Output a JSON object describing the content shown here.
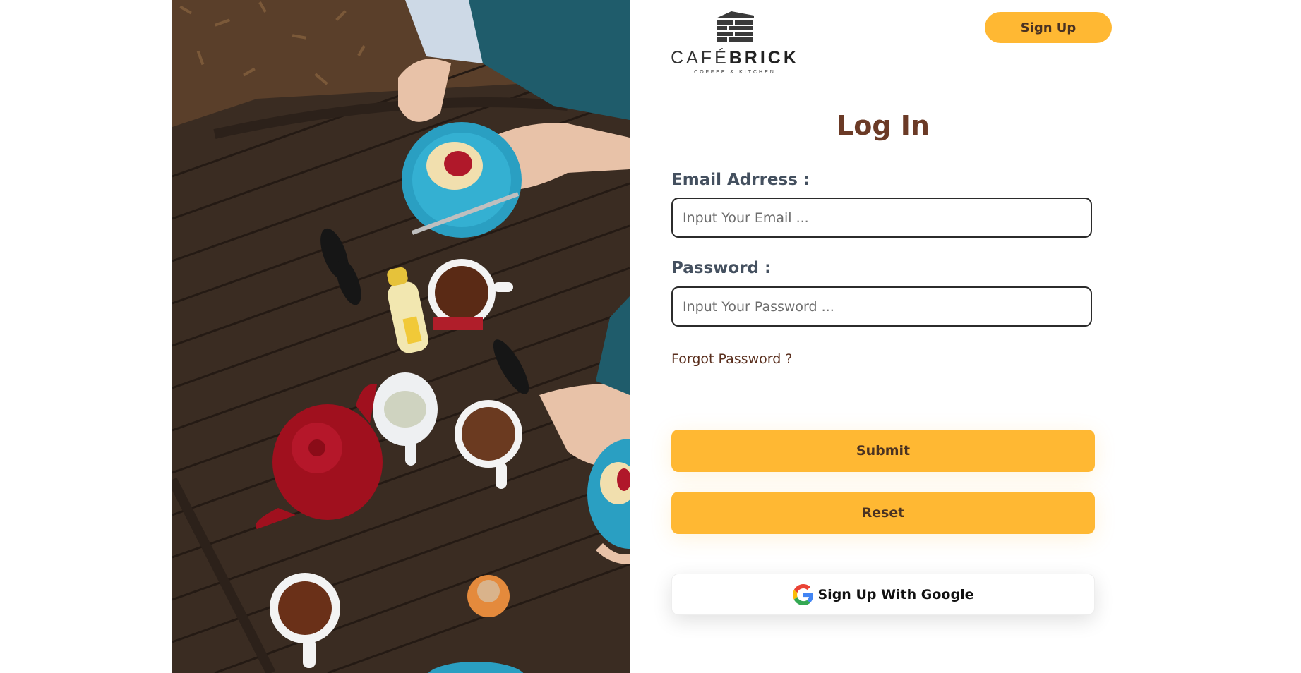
{
  "header": {
    "logo_word_light": "CAFÉ",
    "logo_word_bold": "BRICK",
    "logo_tagline": "COFFEE & KITCHEN",
    "signup_label": "Sign Up"
  },
  "form": {
    "title": "Log In",
    "email_label": "Email Adrress :",
    "email_placeholder": "Input Your Email ...",
    "email_value": "",
    "password_label": "Password :",
    "password_placeholder": "Input Your Password ...",
    "password_value": "",
    "forgot_label": "Forgot Password ?",
    "submit_label": "Submit",
    "reset_label": "Reset",
    "google_label": "Sign Up With Google"
  },
  "icons": {
    "logo": "brick-building-logo",
    "google": "google-g-icon"
  },
  "colors": {
    "accent": "#FFB833",
    "title": "#6B3A26",
    "label": "#44505f",
    "button_text": "#4a3222"
  }
}
